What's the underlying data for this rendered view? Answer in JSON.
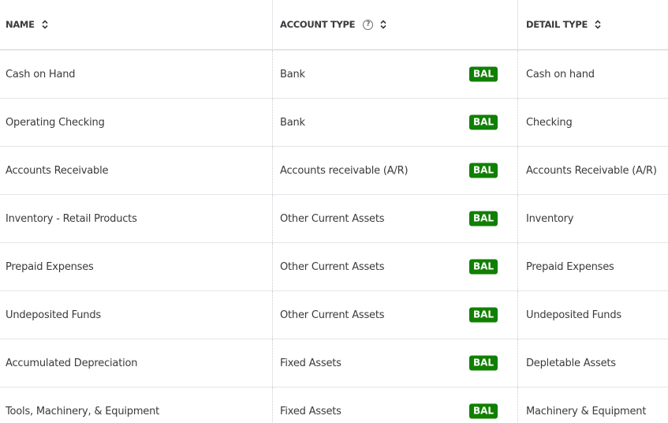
{
  "header": {
    "name": "NAME",
    "account_type": "ACCOUNT TYPE",
    "detail_type": "DETAIL TYPE",
    "help_glyph": "?"
  },
  "rows": [
    {
      "name": "Cash on Hand",
      "account_type": "Bank",
      "badge": "BAL",
      "detail_type": "Cash on hand"
    },
    {
      "name": "Operating Checking",
      "account_type": "Bank",
      "badge": "BAL",
      "detail_type": "Checking"
    },
    {
      "name": "Accounts Receivable",
      "account_type": "Accounts receivable (A/R)",
      "badge": "BAL",
      "detail_type": "Accounts Receivable (A/R)"
    },
    {
      "name": "Inventory - Retail Products",
      "account_type": "Other Current Assets",
      "badge": "BAL",
      "detail_type": "Inventory"
    },
    {
      "name": "Prepaid Expenses",
      "account_type": "Other Current Assets",
      "badge": "BAL",
      "detail_type": "Prepaid Expenses"
    },
    {
      "name": "Undeposited Funds",
      "account_type": "Other Current Assets",
      "badge": "BAL",
      "detail_type": "Undeposited Funds"
    },
    {
      "name": "Accumulated Depreciation",
      "account_type": "Fixed Assets",
      "badge": "BAL",
      "detail_type": "Depletable Assets"
    },
    {
      "name": "Tools, Machinery, & Equipment",
      "account_type": "Fixed Assets",
      "badge": "BAL",
      "detail_type": "Machinery & Equipment"
    }
  ],
  "colors": {
    "badge_bg": "#108000",
    "text": "#393a3d",
    "divider": "#e3e5e8"
  }
}
